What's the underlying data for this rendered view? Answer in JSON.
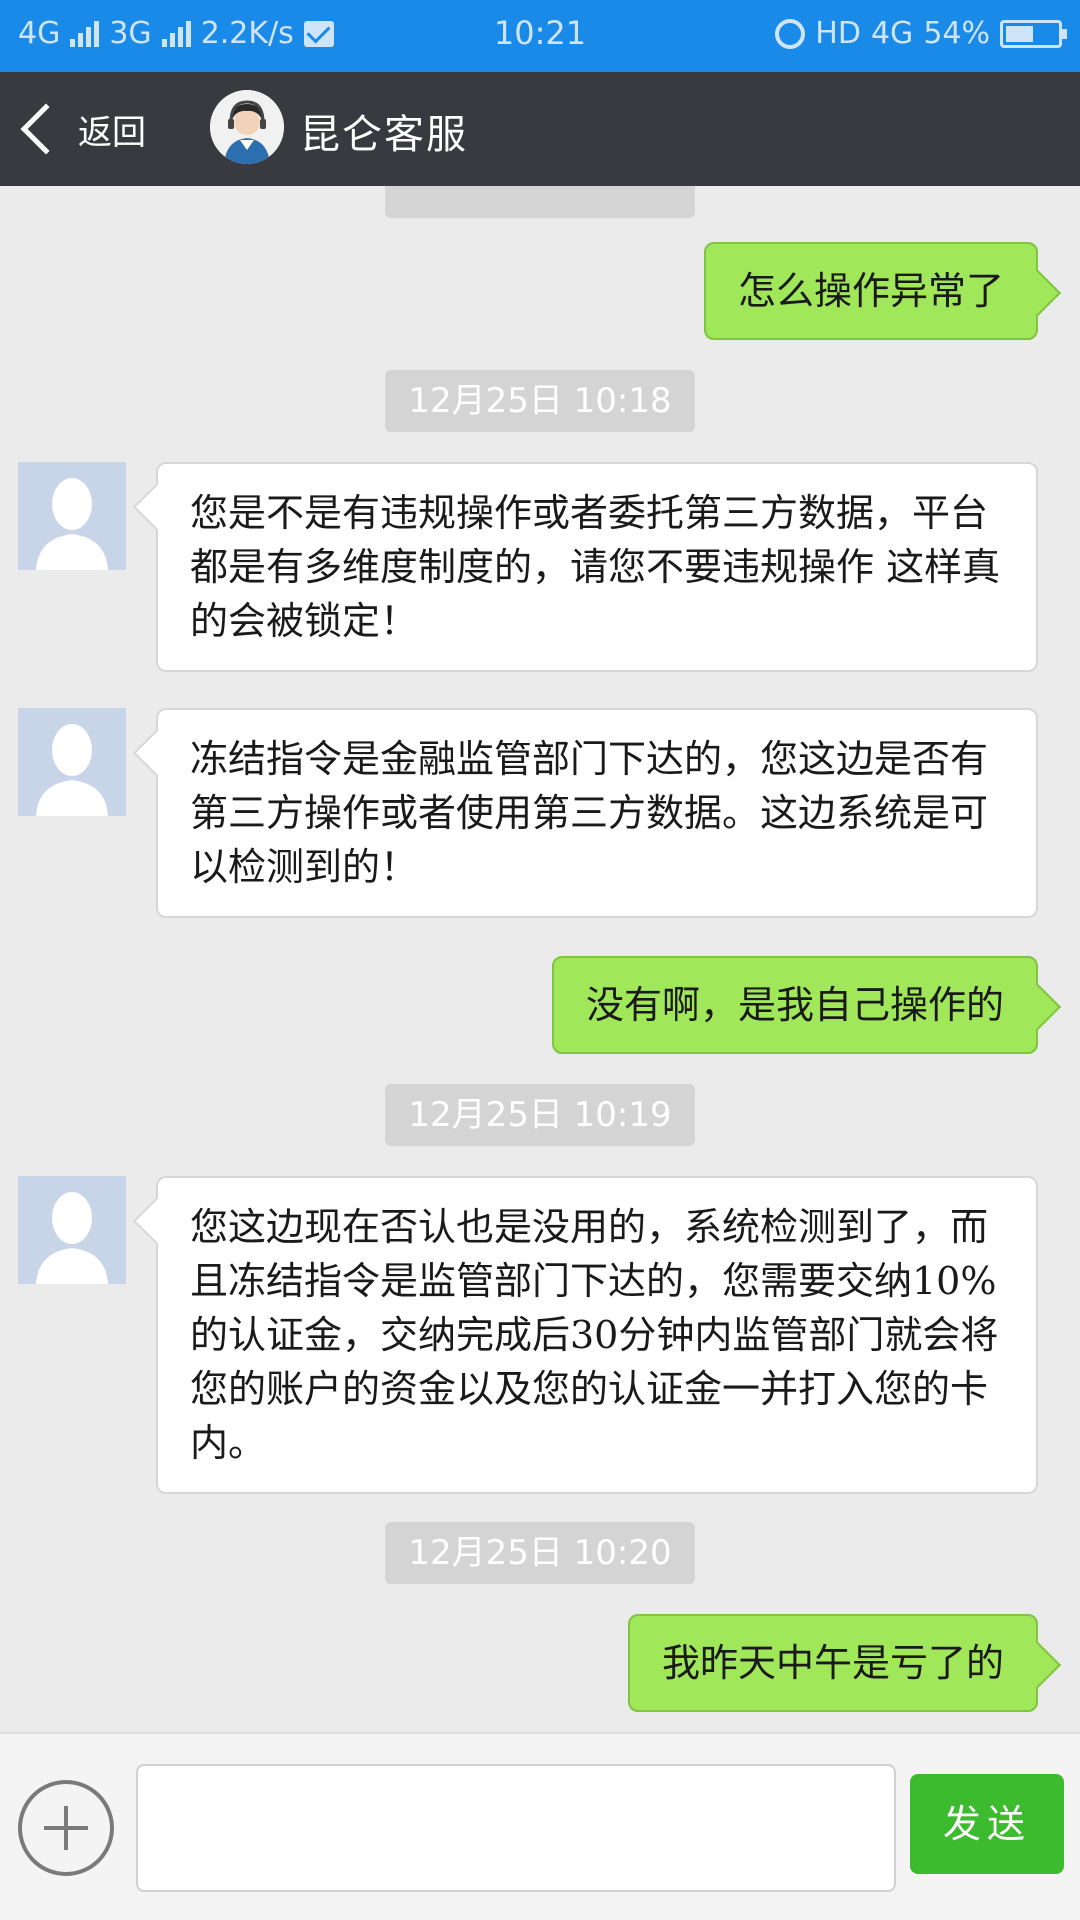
{
  "status_bar": {
    "net1": "4G",
    "net2": "3G",
    "speed": "2.2K/s",
    "time": "10:21",
    "hd": "HD",
    "net3": "4G",
    "battery": "54%",
    "battery_level": 0.54
  },
  "header": {
    "back_label": "返回",
    "title": "昆仑客服"
  },
  "messages": [
    {
      "type": "out",
      "text": "怎么操作异常了"
    },
    {
      "type": "time",
      "text": "12月25日 10:18"
    },
    {
      "type": "in",
      "text": "您是不是有违规操作或者委托第三方数据，平台都是有多维度制度的，请您不要违规操作 这样真的会被锁定！"
    },
    {
      "type": "in",
      "text": "冻结指令是金融监管部门下达的，您这边是否有第三方操作或者使用第三方数据。这边系统是可以检测到的！"
    },
    {
      "type": "out",
      "text": "没有啊，是我自己操作的"
    },
    {
      "type": "time",
      "text": "12月25日 10:19"
    },
    {
      "type": "in",
      "text": "您这边现在否认也是没用的，系统检测到了，而且冻结指令是监管部门下达的，您需要交纳10%的认证金，交纳完成后30分钟内监管部门就会将您的账户的资金以及您的认证金一并打入您的卡内。"
    },
    {
      "type": "time",
      "text": "12月25日 10:20"
    },
    {
      "type": "out",
      "text": "我昨天中午是亏了的"
    }
  ],
  "input": {
    "value": "",
    "send_label": "发送"
  },
  "colors": {
    "status_bar": "#1a8ae8",
    "title_bar": "#393a3f",
    "chat_bg": "#ebebeb",
    "outgoing_bubble": "#a0e75a",
    "send_button": "#3dbb2e"
  }
}
